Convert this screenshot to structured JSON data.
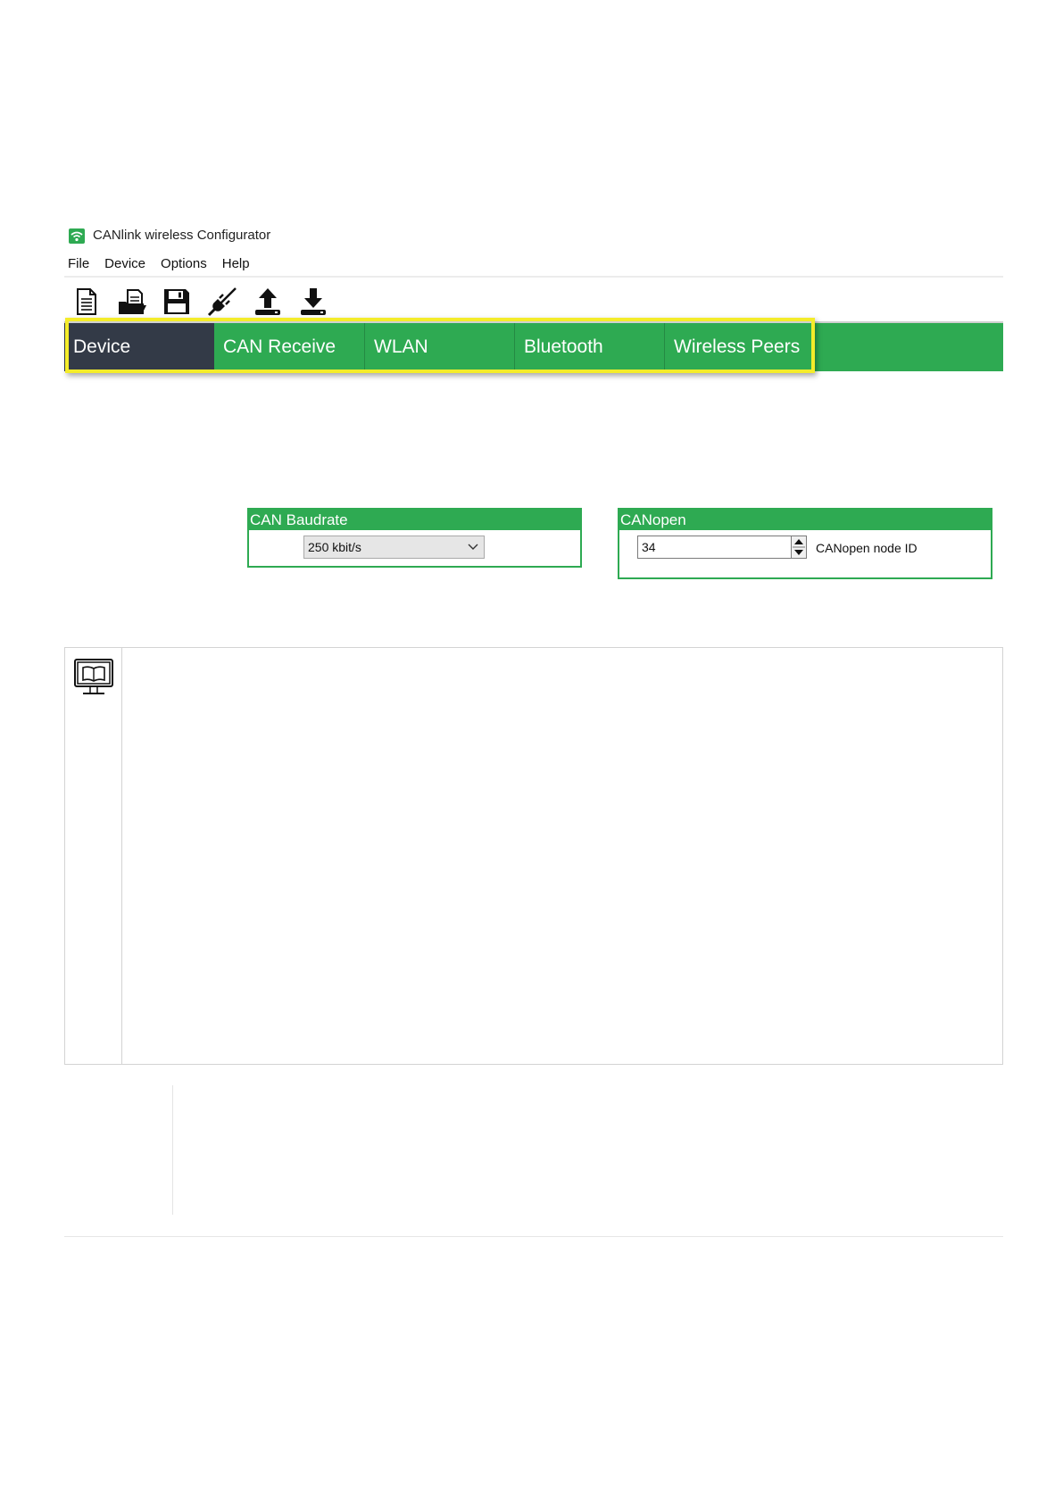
{
  "window": {
    "title": "CANlink wireless Configurator",
    "app_icon": "wifi-icon"
  },
  "menu": [
    "File",
    "Device",
    "Options",
    "Help"
  ],
  "toolbar": [
    {
      "name": "new-document-icon"
    },
    {
      "name": "open-folder-icon"
    },
    {
      "name": "save-disk-icon"
    },
    {
      "name": "disconnect-plug-icon"
    },
    {
      "name": "upload-icon"
    },
    {
      "name": "download-icon"
    }
  ],
  "tabs": [
    {
      "label": "Device",
      "active": true
    },
    {
      "label": "CAN Receive"
    },
    {
      "label": "WLAN"
    },
    {
      "label": "Bluetooth"
    },
    {
      "label": "Wireless Peers"
    }
  ],
  "can_baudrate": {
    "title": "CAN Baudrate",
    "selected": "250 kbit/s"
  },
  "canopen": {
    "title": "CANopen",
    "node_id": "34",
    "node_id_label": "CANopen node ID"
  },
  "note": {
    "icon": "manual-monitor-icon"
  },
  "colors": {
    "accent_green": "#2eaa52",
    "active_tab": "#333a47",
    "highlight": "#f4ec2a"
  }
}
